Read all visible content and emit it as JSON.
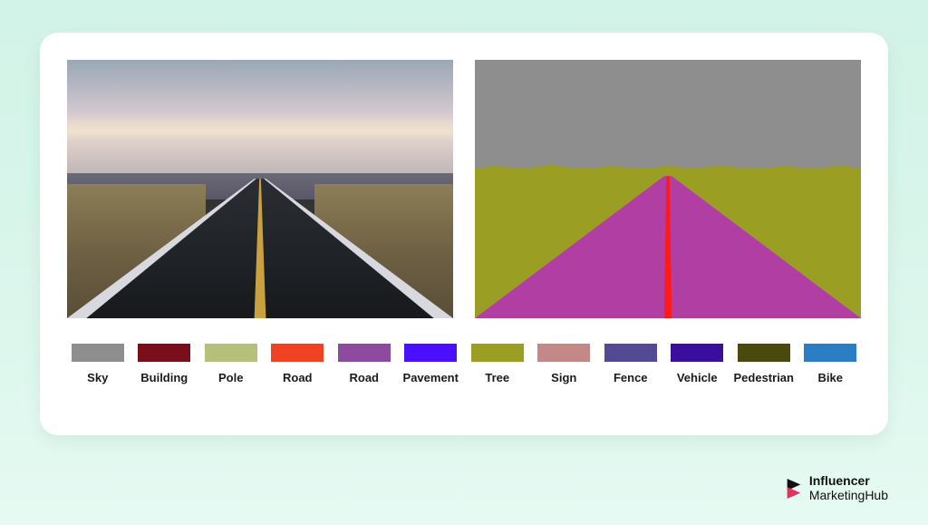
{
  "legend": [
    {
      "label": "Sky",
      "color": "#8e8e8e"
    },
    {
      "label": "Building",
      "color": "#7a0e1a"
    },
    {
      "label": "Pole",
      "color": "#b6c07a"
    },
    {
      "label": "Road",
      "color": "#f04323"
    },
    {
      "label": "Road",
      "color": "#8e4a9e"
    },
    {
      "label": "Pavement",
      "color": "#4b0fff"
    },
    {
      "label": "Tree",
      "color": "#9a9e22"
    },
    {
      "label": "Sign",
      "color": "#c48889"
    },
    {
      "label": "Fence",
      "color": "#544a94"
    },
    {
      "label": "Vehicle",
      "color": "#3b0f9e"
    },
    {
      "label": "Pedestrian",
      "color": "#4a4a0f"
    },
    {
      "label": "Bike",
      "color": "#2b7dc4"
    }
  ],
  "images": {
    "left_alt": "Photograph of a straight highway road at dusk",
    "right_alt": "Semantic segmentation map of the road scene"
  },
  "watermark": {
    "brand_line1": "Influencer",
    "brand_line2": "MarketingHub"
  }
}
